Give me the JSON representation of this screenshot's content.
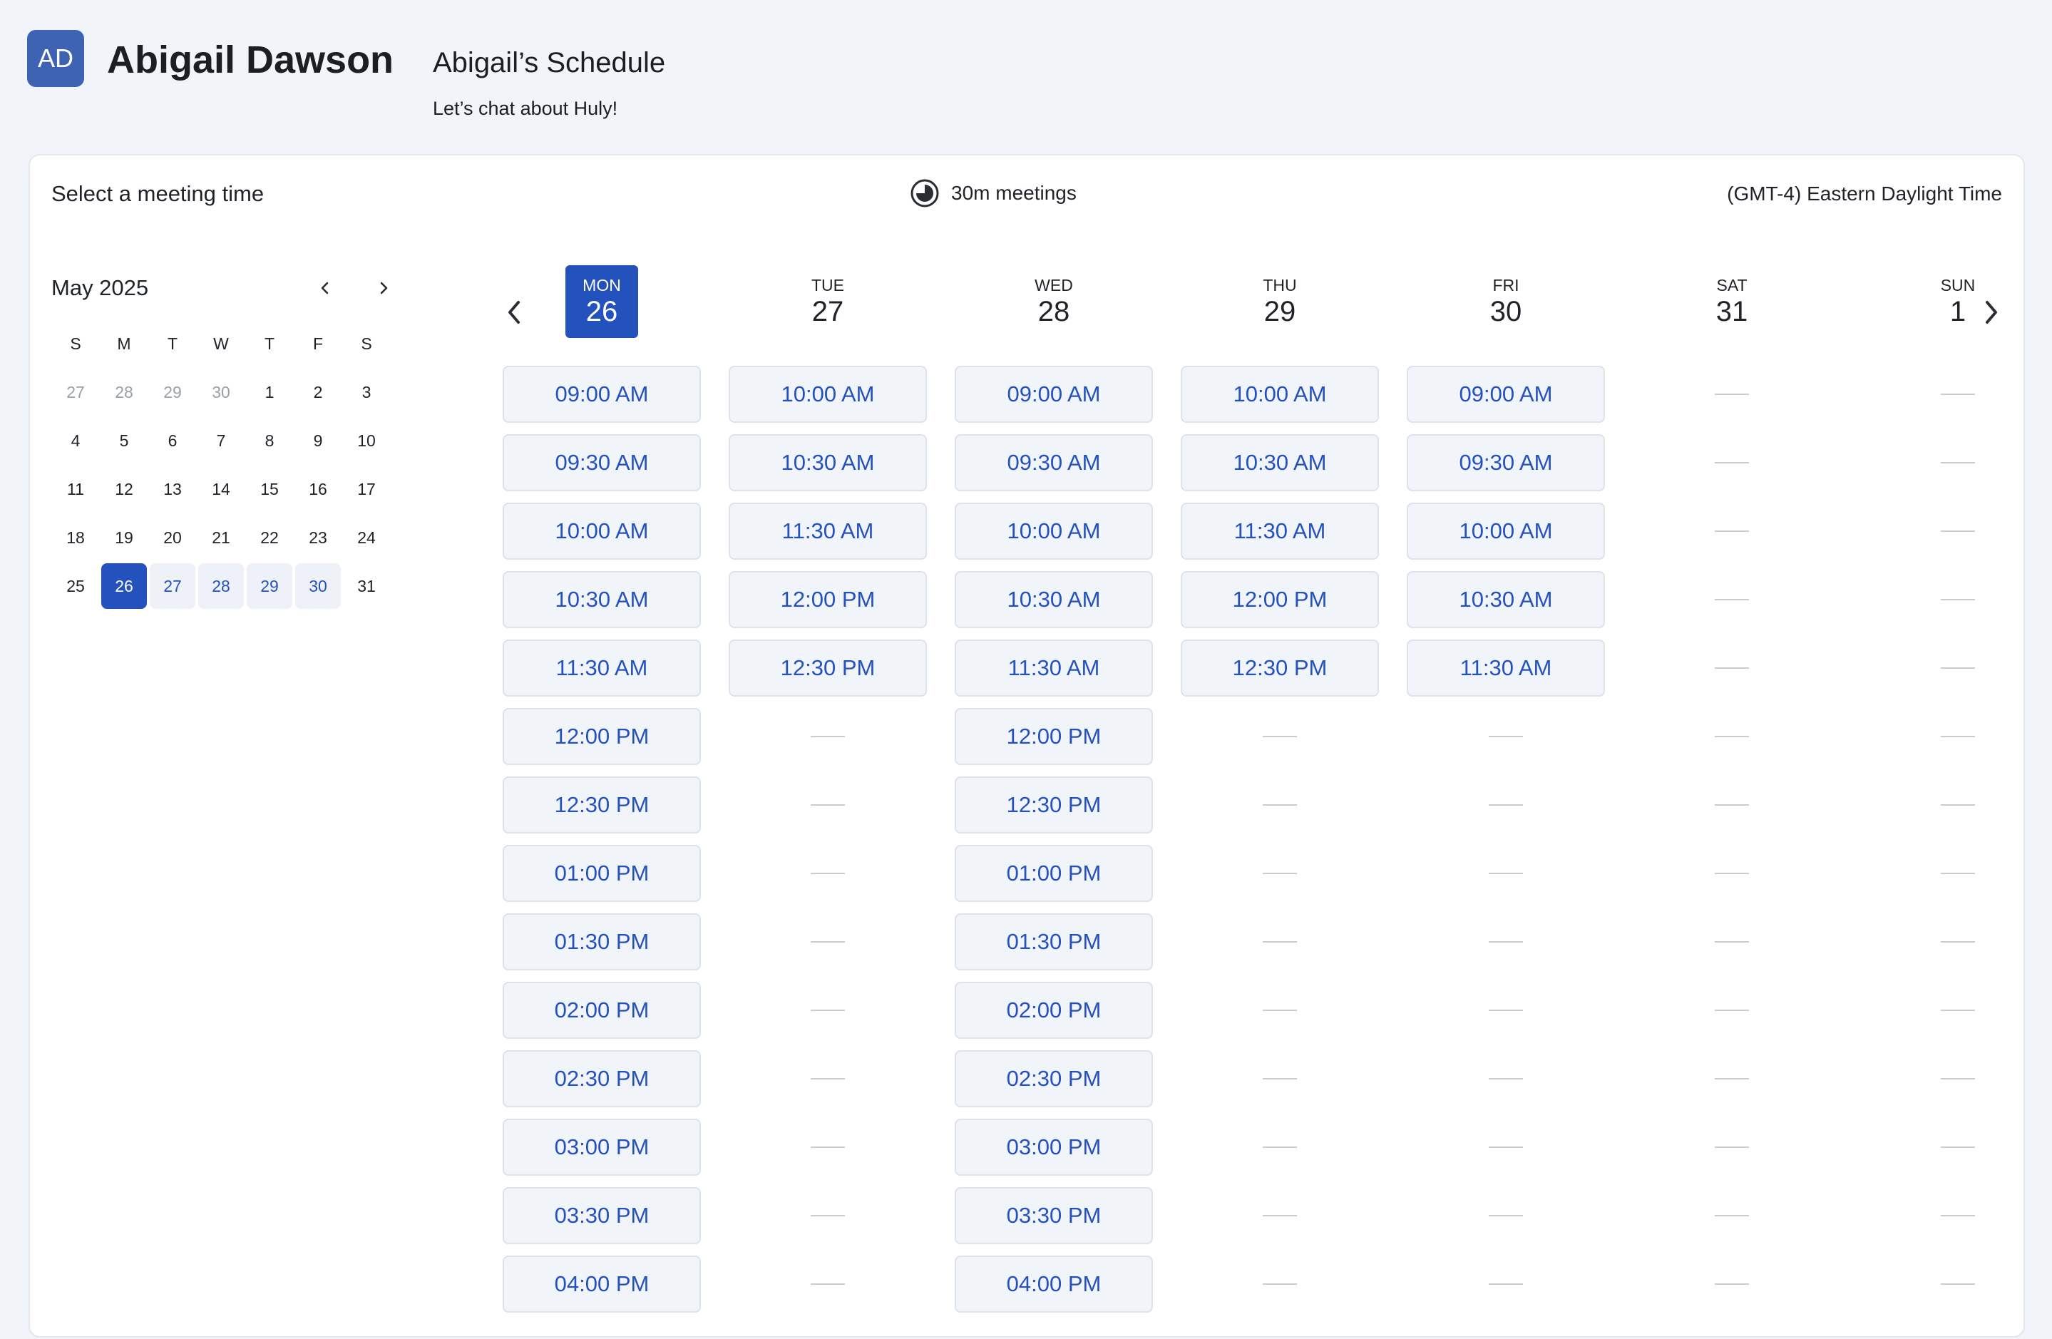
{
  "host": {
    "initials": "AD",
    "name": "Abigail Dawson"
  },
  "schedule": {
    "title": "Abigail’s Schedule",
    "subtitle": "Let’s chat about Huly!"
  },
  "toolbar": {
    "select_label": "Select a meeting time",
    "duration_label": "30m meetings",
    "timezone_label": "(GMT-4) Eastern Daylight Time"
  },
  "mini_calendar": {
    "month_label": "May 2025",
    "weekdays": [
      "S",
      "M",
      "T",
      "W",
      "T",
      "F",
      "S"
    ],
    "weeks": [
      [
        {
          "d": "27",
          "s": "muted"
        },
        {
          "d": "28",
          "s": "muted"
        },
        {
          "d": "29",
          "s": "muted"
        },
        {
          "d": "30",
          "s": "muted"
        },
        {
          "d": "1",
          "s": ""
        },
        {
          "d": "2",
          "s": ""
        },
        {
          "d": "3",
          "s": ""
        }
      ],
      [
        {
          "d": "4",
          "s": ""
        },
        {
          "d": "5",
          "s": ""
        },
        {
          "d": "6",
          "s": ""
        },
        {
          "d": "7",
          "s": ""
        },
        {
          "d": "8",
          "s": ""
        },
        {
          "d": "9",
          "s": ""
        },
        {
          "d": "10",
          "s": ""
        }
      ],
      [
        {
          "d": "11",
          "s": ""
        },
        {
          "d": "12",
          "s": ""
        },
        {
          "d": "13",
          "s": ""
        },
        {
          "d": "14",
          "s": ""
        },
        {
          "d": "15",
          "s": ""
        },
        {
          "d": "16",
          "s": ""
        },
        {
          "d": "17",
          "s": ""
        }
      ],
      [
        {
          "d": "18",
          "s": ""
        },
        {
          "d": "19",
          "s": ""
        },
        {
          "d": "20",
          "s": ""
        },
        {
          "d": "21",
          "s": ""
        },
        {
          "d": "22",
          "s": ""
        },
        {
          "d": "23",
          "s": ""
        },
        {
          "d": "24",
          "s": ""
        }
      ],
      [
        {
          "d": "25",
          "s": ""
        },
        {
          "d": "26",
          "s": "sel"
        },
        {
          "d": "27",
          "s": "avail"
        },
        {
          "d": "28",
          "s": "avail"
        },
        {
          "d": "29",
          "s": "avail"
        },
        {
          "d": "30",
          "s": "avail"
        },
        {
          "d": "31",
          "s": ""
        }
      ]
    ]
  },
  "week": {
    "days": [
      {
        "dow": "MON",
        "num": "26",
        "selected": true,
        "slots": [
          "09:00 AM",
          "09:30 AM",
          "10:00 AM",
          "10:30 AM",
          "11:30 AM",
          "12:00 PM",
          "12:30 PM",
          "01:00 PM",
          "01:30 PM",
          "02:00 PM",
          "02:30 PM",
          "03:00 PM",
          "03:30 PM",
          "04:00 PM"
        ]
      },
      {
        "dow": "TUE",
        "num": "27",
        "selected": false,
        "slots": [
          "10:00 AM",
          "10:30 AM",
          "11:30 AM",
          "12:00 PM",
          "12:30 PM"
        ]
      },
      {
        "dow": "WED",
        "num": "28",
        "selected": false,
        "slots": [
          "09:00 AM",
          "09:30 AM",
          "10:00 AM",
          "10:30 AM",
          "11:30 AM",
          "12:00 PM",
          "12:30 PM",
          "01:00 PM",
          "01:30 PM",
          "02:00 PM",
          "02:30 PM",
          "03:00 PM",
          "03:30 PM",
          "04:00 PM"
        ]
      },
      {
        "dow": "THU",
        "num": "29",
        "selected": false,
        "slots": [
          "10:00 AM",
          "10:30 AM",
          "11:30 AM",
          "12:00 PM",
          "12:30 PM"
        ]
      },
      {
        "dow": "FRI",
        "num": "30",
        "selected": false,
        "slots": [
          "09:00 AM",
          "09:30 AM",
          "10:00 AM",
          "10:30 AM",
          "11:30 AM"
        ]
      },
      {
        "dow": "SAT",
        "num": "31",
        "selected": false,
        "slots": []
      },
      {
        "dow": "SUN",
        "num": "1",
        "selected": false,
        "slots": []
      }
    ]
  },
  "colors": {
    "accent": "#2452bd",
    "avatar": "#3e63b3",
    "slot_bg": "#f1f4f9",
    "page_bg": "#f1f4f9"
  },
  "icons": {
    "duration": "clock-pie-icon",
    "prev": "chevron-left-icon",
    "next": "chevron-right-icon"
  }
}
